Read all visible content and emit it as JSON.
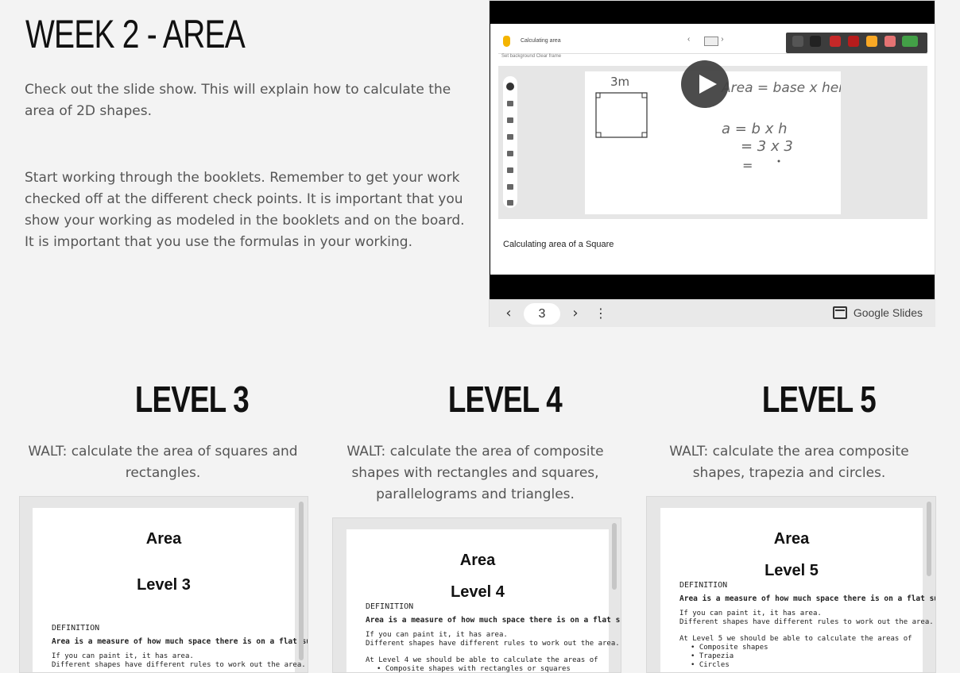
{
  "page": {
    "title": "WEEK 2 - AREA",
    "intro_1": "Check out the slide show. This will explain how to calculate the area of 2D shapes.",
    "intro_2": "Start working through the booklets. Remember to get your work checked off at the different check points. It is important that you show your working as modeled in the booklets and on the board. It is important that you use the formulas in your working."
  },
  "slides": {
    "jamboard_title": "Calculating area",
    "jamboard_subtools": "Set background    Clear frame",
    "handwriting_side": "3m",
    "handwriting_formula": "Area = base x height",
    "handwriting_calc1": "a = b x h",
    "handwriting_calc2": "= 3 x 3",
    "handwriting_calc3": "=",
    "caption": "Calculating area of a Square",
    "current_page": "3",
    "brand": "Google Slides"
  },
  "levels": [
    {
      "title": "LEVEL 3",
      "walt": "WALT: calculate the area of squares and rectangles.",
      "doc_title": "Area",
      "doc_level": "Level 3",
      "definition_label": "DEFINITION",
      "definition": "Area is a measure of how much space there is on a flat surface",
      "line1": "If you can paint it, it has area.",
      "line2": "Different shapes have different rules to work out the area."
    },
    {
      "title": "LEVEL 4",
      "walt": "WALT: calculate the area of composite shapes with rectangles and squares, parallelograms and triangles.",
      "doc_title": "Area",
      "doc_level": "Level 4",
      "definition_label": "DEFINITION",
      "definition": "Area is a measure of how much space there is on a flat surface",
      "line1": "If you can paint it, it has area.",
      "line2": "Different shapes have different rules to work out the area.",
      "line3": "At Level 4 we should be able to calculate the areas of",
      "bullets": [
        "Composite shapes with rectangles or squares"
      ]
    },
    {
      "title": "LEVEL 5",
      "walt": "WALT: calculate the area composite shapes, trapezia and circles.",
      "doc_title": "Area",
      "doc_level": "Level 5",
      "definition_label": "DEFINITION",
      "definition": "Area is a measure of how much space there is on a flat surface",
      "line1": "If you can paint it, it has area.",
      "line2": "Different shapes have different rules to work out the area.",
      "line3": "At Level 5 we should be able to calculate the areas of",
      "bullets": [
        "Composite shapes",
        "Trapezia",
        "Circles"
      ]
    }
  ]
}
